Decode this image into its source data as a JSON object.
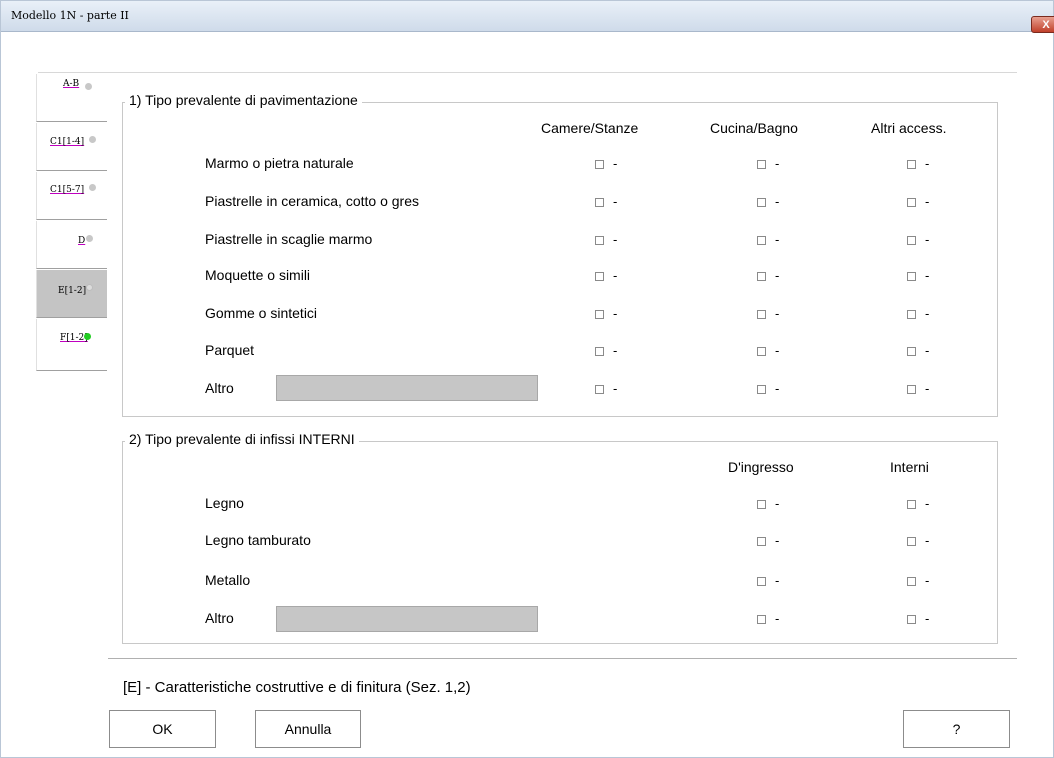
{
  "window": {
    "title": "Modello 1N -   parte II",
    "close_label": "X"
  },
  "tabs": [
    {
      "label": "A-B",
      "status": "gray"
    },
    {
      "label": "C1[1-4]",
      "status": "gray"
    },
    {
      "label": "C1[5-7]",
      "status": "gray"
    },
    {
      "label": "D",
      "status": "gray"
    },
    {
      "label": "E[1-2]",
      "status": "hollow",
      "selected": true
    },
    {
      "label": "F[1-2]",
      "status": "green"
    }
  ],
  "section1": {
    "title": "1) Tipo prevalente di pavimentazione",
    "columns": [
      "Camere/Stanze",
      "Cucina/Bagno",
      "Altri access."
    ],
    "rows": [
      "Marmo o pietra naturale",
      "Piastrelle in ceramica, cotto o gres",
      "Piastrelle in scaglie marmo",
      "Moquette o simili",
      "Gomme o sintetici",
      "Parquet",
      "Altro"
    ],
    "altro_value": ""
  },
  "section2": {
    "title": "2) Tipo prevalente di infissi INTERNI",
    "columns": [
      "D'ingresso",
      "Interni"
    ],
    "rows": [
      "Legno",
      "Legno tamburato",
      "Metallo",
      "Altro"
    ],
    "altro_value": ""
  },
  "checkbox_suffix": "-",
  "footer": {
    "status": "[E] - Caratteristiche costruttive e di finitura (Sez. 1,2)",
    "ok_label": "OK",
    "cancel_label": "Annulla",
    "help_label": "?"
  },
  "colors": {
    "tab_selected": "#c4c4c4",
    "status_green": "#22cc22",
    "textbox": "#c6c6c6"
  }
}
